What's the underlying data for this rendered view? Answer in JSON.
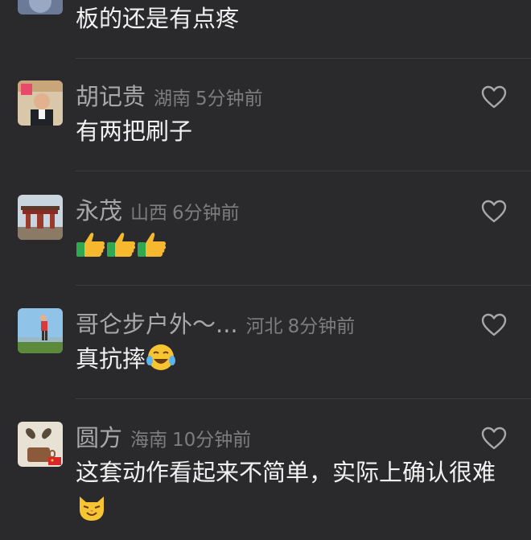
{
  "comments": [
    {
      "username": "",
      "location": "",
      "time": "",
      "text": "板的还是有点疼"
    },
    {
      "username": "胡记贵",
      "location": "湖南",
      "time": "5分钟前",
      "text": "有两把刷子"
    },
    {
      "username": "永茂",
      "location": "山西",
      "time": "6分钟前",
      "text": "",
      "emojis": [
        "thumbs-up-emoji",
        "thumbs-up-emoji",
        "thumbs-up-emoji"
      ]
    },
    {
      "username": "哥仑步户外～...",
      "location": "河北",
      "time": "8分钟前",
      "text": "真抗摔",
      "emojis": [
        "laugh-cry-emoji"
      ]
    },
    {
      "username": "圆方",
      "location": "海南",
      "time": "10分钟前",
      "text": "这套动作看起来不简单，实际上确认很难",
      "emojis": [
        "cat-face-emoji"
      ]
    }
  ],
  "icons": {
    "like": "heart-outline-icon"
  },
  "colors": {
    "background": "#2a2a2c",
    "username": "#a8a8ab",
    "meta": "#7d7d80",
    "text": "#f1f1f1",
    "divider": "#3d3d40"
  }
}
